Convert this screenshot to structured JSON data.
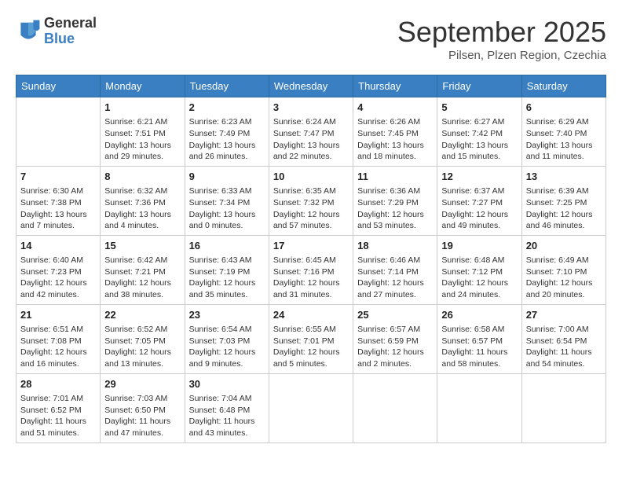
{
  "header": {
    "logo": {
      "general": "General",
      "blue": "Blue"
    },
    "title": "September 2025",
    "location": "Pilsen, Plzen Region, Czechia"
  },
  "weekdays": [
    "Sunday",
    "Monday",
    "Tuesday",
    "Wednesday",
    "Thursday",
    "Friday",
    "Saturday"
  ],
  "weeks": [
    [
      {
        "day": null
      },
      {
        "day": "1",
        "sunrise": "6:21 AM",
        "sunset": "7:51 PM",
        "daylight": "13 hours and 29 minutes."
      },
      {
        "day": "2",
        "sunrise": "6:23 AM",
        "sunset": "7:49 PM",
        "daylight": "13 hours and 26 minutes."
      },
      {
        "day": "3",
        "sunrise": "6:24 AM",
        "sunset": "7:47 PM",
        "daylight": "13 hours and 22 minutes."
      },
      {
        "day": "4",
        "sunrise": "6:26 AM",
        "sunset": "7:45 PM",
        "daylight": "13 hours and 18 minutes."
      },
      {
        "day": "5",
        "sunrise": "6:27 AM",
        "sunset": "7:42 PM",
        "daylight": "13 hours and 15 minutes."
      },
      {
        "day": "6",
        "sunrise": "6:29 AM",
        "sunset": "7:40 PM",
        "daylight": "13 hours and 11 minutes."
      }
    ],
    [
      {
        "day": "7",
        "sunrise": "6:30 AM",
        "sunset": "7:38 PM",
        "daylight": "13 hours and 7 minutes."
      },
      {
        "day": "8",
        "sunrise": "6:32 AM",
        "sunset": "7:36 PM",
        "daylight": "13 hours and 4 minutes."
      },
      {
        "day": "9",
        "sunrise": "6:33 AM",
        "sunset": "7:34 PM",
        "daylight": "13 hours and 0 minutes."
      },
      {
        "day": "10",
        "sunrise": "6:35 AM",
        "sunset": "7:32 PM",
        "daylight": "12 hours and 57 minutes."
      },
      {
        "day": "11",
        "sunrise": "6:36 AM",
        "sunset": "7:29 PM",
        "daylight": "12 hours and 53 minutes."
      },
      {
        "day": "12",
        "sunrise": "6:37 AM",
        "sunset": "7:27 PM",
        "daylight": "12 hours and 49 minutes."
      },
      {
        "day": "13",
        "sunrise": "6:39 AM",
        "sunset": "7:25 PM",
        "daylight": "12 hours and 46 minutes."
      }
    ],
    [
      {
        "day": "14",
        "sunrise": "6:40 AM",
        "sunset": "7:23 PM",
        "daylight": "12 hours and 42 minutes."
      },
      {
        "day": "15",
        "sunrise": "6:42 AM",
        "sunset": "7:21 PM",
        "daylight": "12 hours and 38 minutes."
      },
      {
        "day": "16",
        "sunrise": "6:43 AM",
        "sunset": "7:19 PM",
        "daylight": "12 hours and 35 minutes."
      },
      {
        "day": "17",
        "sunrise": "6:45 AM",
        "sunset": "7:16 PM",
        "daylight": "12 hours and 31 minutes."
      },
      {
        "day": "18",
        "sunrise": "6:46 AM",
        "sunset": "7:14 PM",
        "daylight": "12 hours and 27 minutes."
      },
      {
        "day": "19",
        "sunrise": "6:48 AM",
        "sunset": "7:12 PM",
        "daylight": "12 hours and 24 minutes."
      },
      {
        "day": "20",
        "sunrise": "6:49 AM",
        "sunset": "7:10 PM",
        "daylight": "12 hours and 20 minutes."
      }
    ],
    [
      {
        "day": "21",
        "sunrise": "6:51 AM",
        "sunset": "7:08 PM",
        "daylight": "12 hours and 16 minutes."
      },
      {
        "day": "22",
        "sunrise": "6:52 AM",
        "sunset": "7:05 PM",
        "daylight": "12 hours and 13 minutes."
      },
      {
        "day": "23",
        "sunrise": "6:54 AM",
        "sunset": "7:03 PM",
        "daylight": "12 hours and 9 minutes."
      },
      {
        "day": "24",
        "sunrise": "6:55 AM",
        "sunset": "7:01 PM",
        "daylight": "12 hours and 5 minutes."
      },
      {
        "day": "25",
        "sunrise": "6:57 AM",
        "sunset": "6:59 PM",
        "daylight": "12 hours and 2 minutes."
      },
      {
        "day": "26",
        "sunrise": "6:58 AM",
        "sunset": "6:57 PM",
        "daylight": "11 hours and 58 minutes."
      },
      {
        "day": "27",
        "sunrise": "7:00 AM",
        "sunset": "6:54 PM",
        "daylight": "11 hours and 54 minutes."
      }
    ],
    [
      {
        "day": "28",
        "sunrise": "7:01 AM",
        "sunset": "6:52 PM",
        "daylight": "11 hours and 51 minutes."
      },
      {
        "day": "29",
        "sunrise": "7:03 AM",
        "sunset": "6:50 PM",
        "daylight": "11 hours and 47 minutes."
      },
      {
        "day": "30",
        "sunrise": "7:04 AM",
        "sunset": "6:48 PM",
        "daylight": "11 hours and 43 minutes."
      },
      {
        "day": null
      },
      {
        "day": null
      },
      {
        "day": null
      },
      {
        "day": null
      }
    ]
  ],
  "labels": {
    "sunrise": "Sunrise:",
    "sunset": "Sunset:",
    "daylight": "Daylight:"
  }
}
